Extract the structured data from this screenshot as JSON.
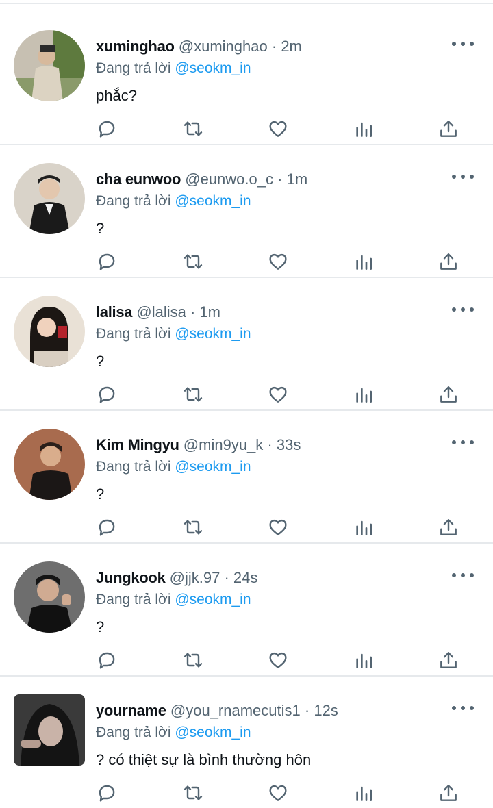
{
  "reply_prefix": "Đang trả lời",
  "colors": {
    "text": "#0f1419",
    "secondary": "#536471",
    "mention": "#1d9bf0",
    "divider": "#e6e9ec"
  },
  "action_icons": [
    "reply-icon",
    "retweet-icon",
    "like-icon",
    "analytics-icon",
    "share-icon"
  ],
  "tweets": [
    {
      "name": "xuminghao",
      "handle": "@xuminghao",
      "separator": "·",
      "time": "2m",
      "reply_to": "@seokm_in",
      "text": "phắc?"
    },
    {
      "name": "cha eunwoo",
      "handle": "@eunwo.o_c",
      "separator": "·",
      "time": "1m",
      "reply_to": "@seokm_in",
      "text": "?"
    },
    {
      "name": "lalisa",
      "handle": "@lalisa",
      "separator": "·",
      "time": "1m",
      "reply_to": "@seokm_in",
      "text": "?"
    },
    {
      "name": "Kim Mingyu",
      "handle": "@min9yu_k",
      "separator": "·",
      "time": "33s",
      "reply_to": "@seokm_in",
      "text": "?"
    },
    {
      "name": "Jungkook",
      "handle": "@jjk.97",
      "separator": "·",
      "time": "24s",
      "reply_to": "@seokm_in",
      "text": "?"
    },
    {
      "name": "yourname",
      "handle": "@you_rnamecutis1",
      "separator": "·",
      "time": "12s",
      "reply_to": "@seokm_in",
      "text": "? có thiệt sự là bình thường hôn"
    }
  ]
}
